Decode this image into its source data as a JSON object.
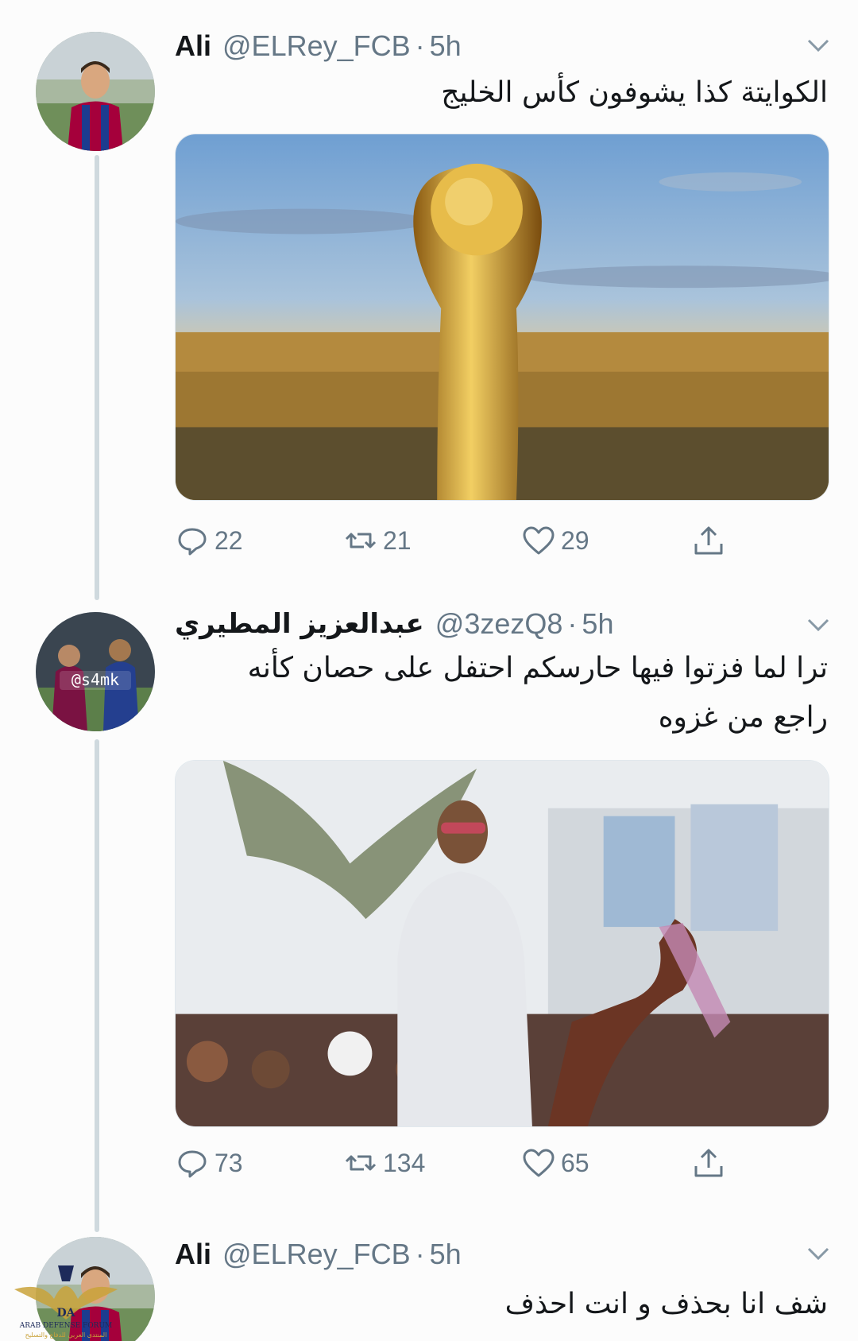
{
  "tweets": [
    {
      "name": "Ali",
      "handle": "@ELRey_FCB",
      "dot": "·",
      "time": "5h",
      "text": "الكوايتة كذا يشوفون كأس الخليج",
      "media_alt": "World Cup trophy in front of a city skyline",
      "actions": {
        "replies": "22",
        "retweets": "21",
        "likes": "29"
      }
    },
    {
      "name": "عبدالعزيز المطيري",
      "handle": "@3zezQ8",
      "dot": "·",
      "time": "5h",
      "avatar_tag": "@s4mk",
      "text_line1": "ترا لما فزتوا فيها حارسكم احتفل على حصان كأنه",
      "text_line2": "راجع من غزوه",
      "media_alt": "Man in white hoodie riding a decorated horse among a crowd",
      "actions": {
        "replies": "73",
        "retweets": "134",
        "likes": "65"
      }
    },
    {
      "name": "Ali",
      "handle": "@ELRey_FCB",
      "dot": "·",
      "time": "5h",
      "text": "شف انا بحذف و انت احذف"
    }
  ],
  "watermark": {
    "brand": "DA",
    "line1": "ARAB DEFENSE FORUM",
    "line2": "المنتدى العربي للدفاع والتسليح"
  },
  "icons": [
    "reply-icon",
    "retweet-icon",
    "like-icon",
    "share-icon",
    "caret-down-icon"
  ],
  "colors": {
    "meta": "#657786",
    "thread_line": "#cfd9de",
    "text": "#14171a"
  }
}
